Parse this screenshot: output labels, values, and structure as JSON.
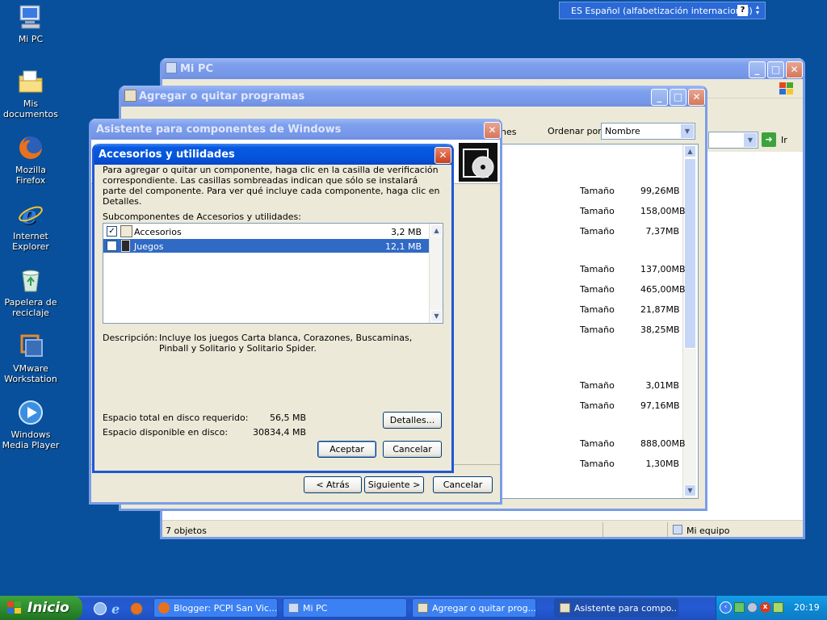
{
  "desktop": {
    "icons": [
      {
        "label": "Mi PC"
      },
      {
        "label": "Mis documentos"
      },
      {
        "label": "Mozilla Firefox"
      },
      {
        "label": "Internet Explorer"
      },
      {
        "label": "Papelera de reciclaje"
      },
      {
        "label": "VMware Workstation"
      },
      {
        "label": "Windows Media Player"
      }
    ]
  },
  "langbar": {
    "text": "ES Español (alfabetización internacional)"
  },
  "mypc": {
    "title": "Mi PC",
    "go_label": "Ir",
    "status_left": "7 objetos",
    "status_right": "Mi equipo"
  },
  "addremove": {
    "title": "Agregar o quitar programas",
    "partial_label": "nes",
    "sort_label": "Ordenar por:",
    "sort_value": "Nombre",
    "size_label": "Tamaño",
    "rows": [
      {
        "label": "Tamaño",
        "value": "99,26MB"
      },
      {
        "label": "Tamaño",
        "value": "158,00MB"
      },
      {
        "label": "Tamaño",
        "value": "7,37MB"
      },
      {
        "label": "Tamaño",
        "value": "137,00MB"
      },
      {
        "label": "Tamaño",
        "value": "465,00MB"
      },
      {
        "label": "Tamaño",
        "value": "21,87MB"
      },
      {
        "label": "Tamaño",
        "value": "38,25MB"
      },
      {
        "label": "Tamaño",
        "value": "3,01MB"
      },
      {
        "label": "Tamaño",
        "value": "97,16MB"
      },
      {
        "label": "Tamaño",
        "value": "888,00MB"
      },
      {
        "label": "Tamaño",
        "value": "1,30MB"
      }
    ]
  },
  "wizard": {
    "title": "Asistente para componentes de Windows",
    "back_label": "< Atrás",
    "next_label": "Siguiente >",
    "cancel_label": "Cancelar"
  },
  "dialog": {
    "title": "Accesorios y utilidades",
    "intro": "Para agregar o quitar un componente, haga clic en la casilla de verificación correspondiente. Las casillas sombreadas indican que sólo se instalará parte del componente. Para ver qué incluye cada componente, haga clic en Detalles.",
    "list_label": "Subcomponentes de Accesorios y utilidades:",
    "items": [
      {
        "name": "Accesorios",
        "size": "3,2 MB",
        "checked": "✓"
      },
      {
        "name": "Juegos",
        "size": "12,1 MB",
        "checked": ""
      }
    ],
    "desc_label": "Descripción:",
    "desc_text": "Incluye los juegos Carta blanca, Corazones, Buscaminas, Pinball y Solitario y Solitario Spider.",
    "req_label": "Espacio total en disco requerido:",
    "req_value": "56,5 MB",
    "avail_label": "Espacio disponible en disco:",
    "avail_value": "30834,4 MB",
    "details_label": "Detalles...",
    "ok_label": "Aceptar",
    "cancel_label": "Cancelar"
  },
  "taskbar": {
    "start_label": "Inicio",
    "tasks": [
      {
        "label": "Blogger: PCPI San Vic..."
      },
      {
        "label": "Mi PC"
      },
      {
        "label": "Agregar o quitar prog..."
      },
      {
        "label": "Asistente para compo..."
      }
    ],
    "clock": "20:19"
  }
}
